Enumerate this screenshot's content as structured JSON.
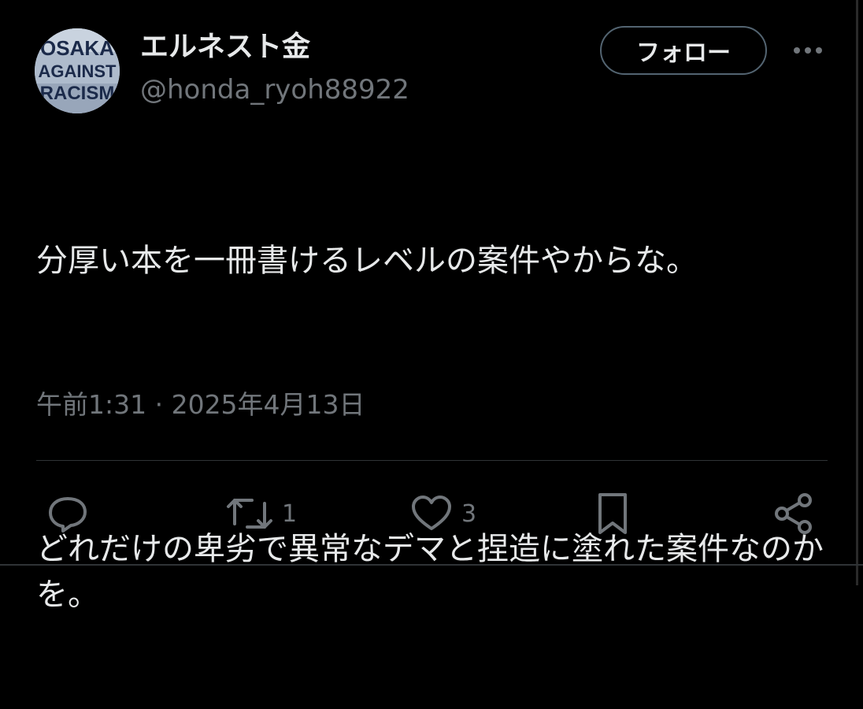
{
  "user": {
    "display_name": "エルネスト金",
    "handle": "@honda_ryoh88922",
    "avatar_text": [
      "OSAKA",
      "AGAINST",
      "RACISM"
    ]
  },
  "header": {
    "follow_label": "フォロー",
    "more_icon": "more-horizontal-icon"
  },
  "tweet": {
    "paragraph1": "分厚い本を一冊書けるレベルの案件やからな。",
    "paragraph2": "どれだけの卑劣で異常なデマと捏造に塗れた案件なのかを。",
    "timestamp": "午前1:31 · 2025年4月13日"
  },
  "actions": {
    "reply_icon": "reply-icon",
    "retweet_icon": "retweet-icon",
    "retweet_count": "1",
    "like_icon": "heart-icon",
    "like_count": "3",
    "bookmark_icon": "bookmark-icon",
    "share_icon": "share-icon"
  },
  "colors": {
    "background": "#000000",
    "primary_text": "#e7e9ea",
    "secondary_text": "#71767b",
    "border": "#2f3336"
  }
}
